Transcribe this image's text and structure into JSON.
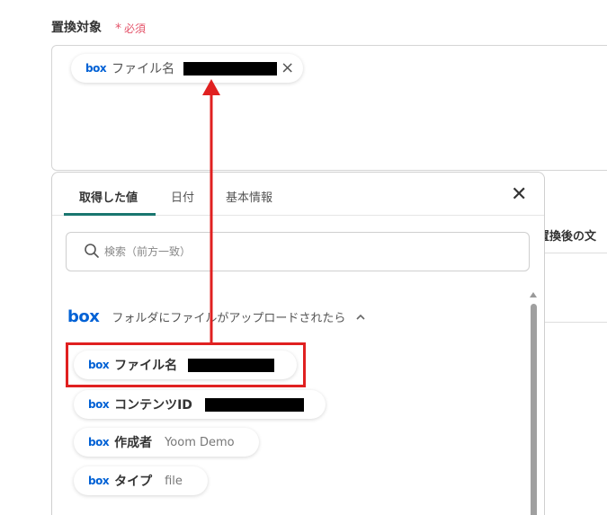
{
  "field": {
    "label": "置換対象",
    "required_star": "*",
    "required_text": "必須"
  },
  "selected_chip": {
    "logo": "box",
    "label": "ファイル名"
  },
  "background_label": "置換後の文",
  "popup": {
    "tabs": [
      {
        "label": "取得した値",
        "active": true
      },
      {
        "label": "日付",
        "active": false
      },
      {
        "label": "基本情報",
        "active": false
      }
    ],
    "search_placeholder": "検索（前方一致）",
    "section": {
      "logo": "box",
      "title": "フォルダにファイルがアップロードされたら"
    },
    "items": [
      {
        "logo": "box",
        "label": "ファイル名",
        "value": ""
      },
      {
        "logo": "box",
        "label": "コンテンツID",
        "value": ""
      },
      {
        "logo": "box",
        "label": "作成者",
        "value": "Yoom Demo"
      },
      {
        "logo": "box",
        "label": "タイプ",
        "value": "file"
      }
    ]
  },
  "colors": {
    "accent_tab": "#19766f",
    "highlight": "#e02020",
    "box_brand": "#0061d5",
    "required": "#e4556b"
  }
}
